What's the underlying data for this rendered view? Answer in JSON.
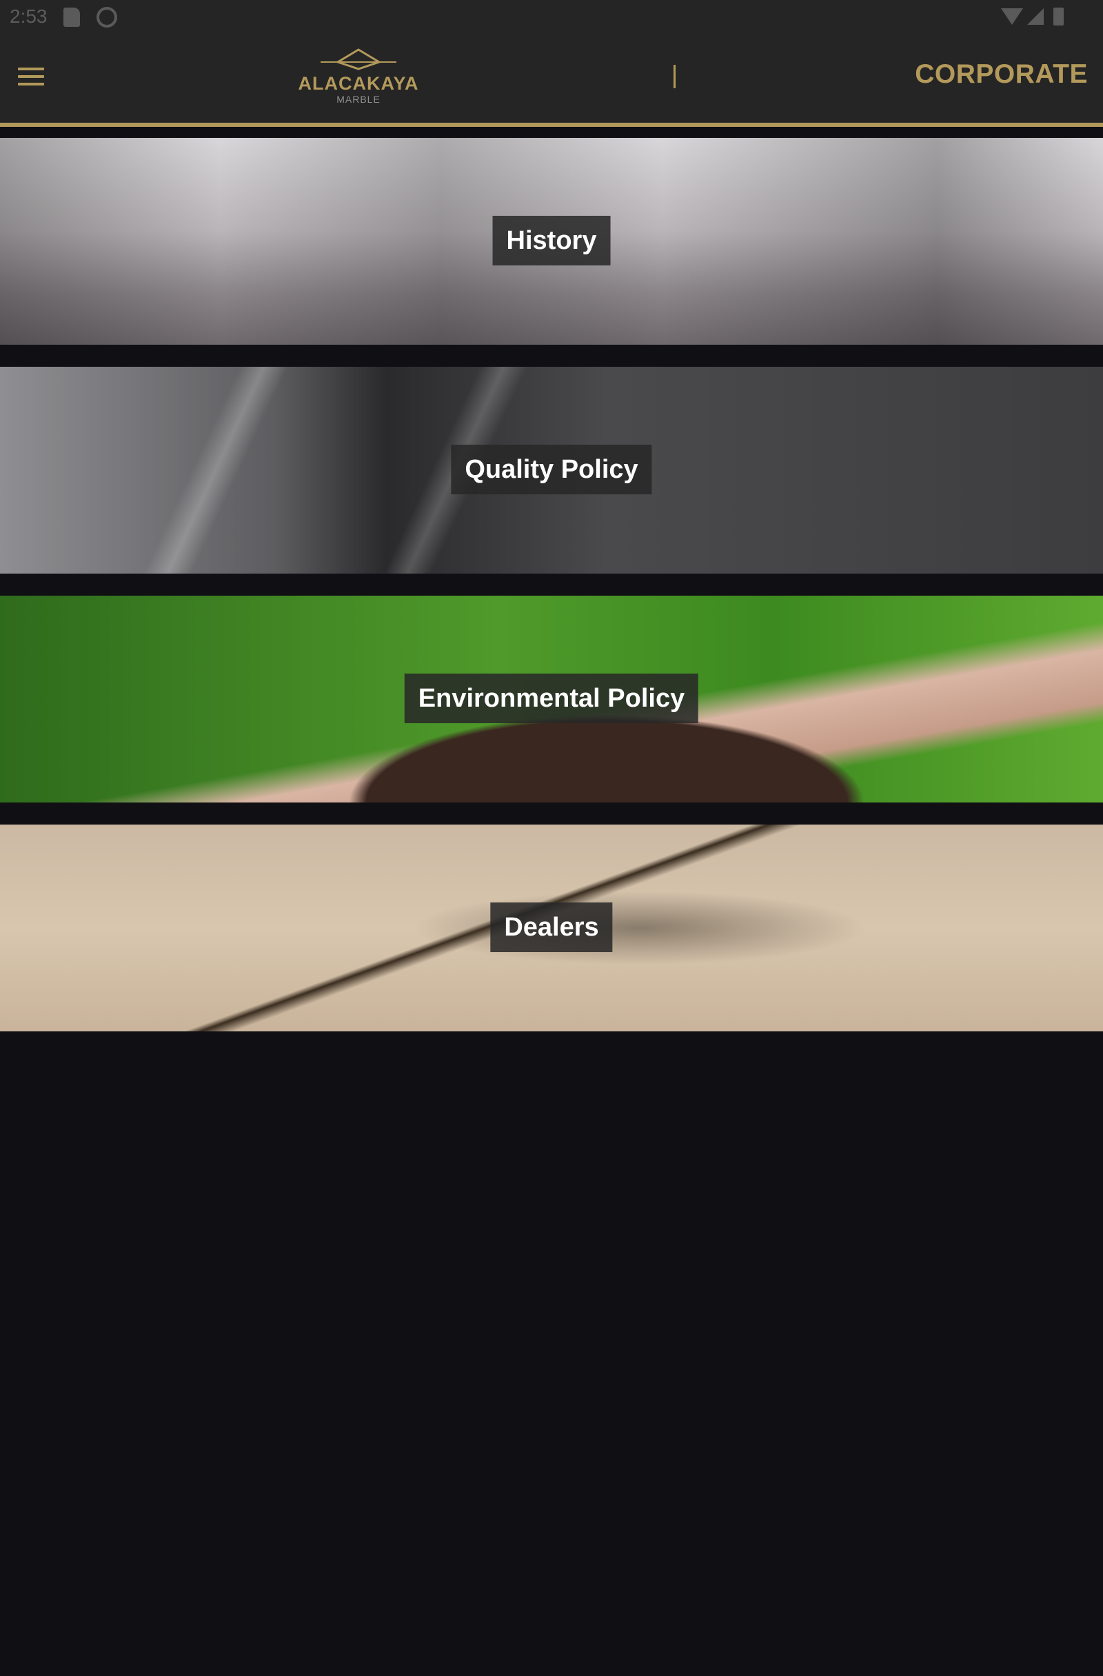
{
  "status_bar": {
    "time": "2:53",
    "icons": [
      "sd-card-icon",
      "circle-icon",
      "wifi-icon",
      "signal-icon",
      "battery-icon"
    ]
  },
  "app_bar": {
    "menu_icon": "hamburger-menu-icon",
    "logo_text": "ALACAKAYA",
    "logo_sub": "MARBLE",
    "title": "CORPORATE",
    "accent_color": "#b39a5b"
  },
  "banners": [
    {
      "label": "History"
    },
    {
      "label": "Quality Policy"
    },
    {
      "label": "Environmental Policy"
    },
    {
      "label": "Dealers"
    }
  ]
}
